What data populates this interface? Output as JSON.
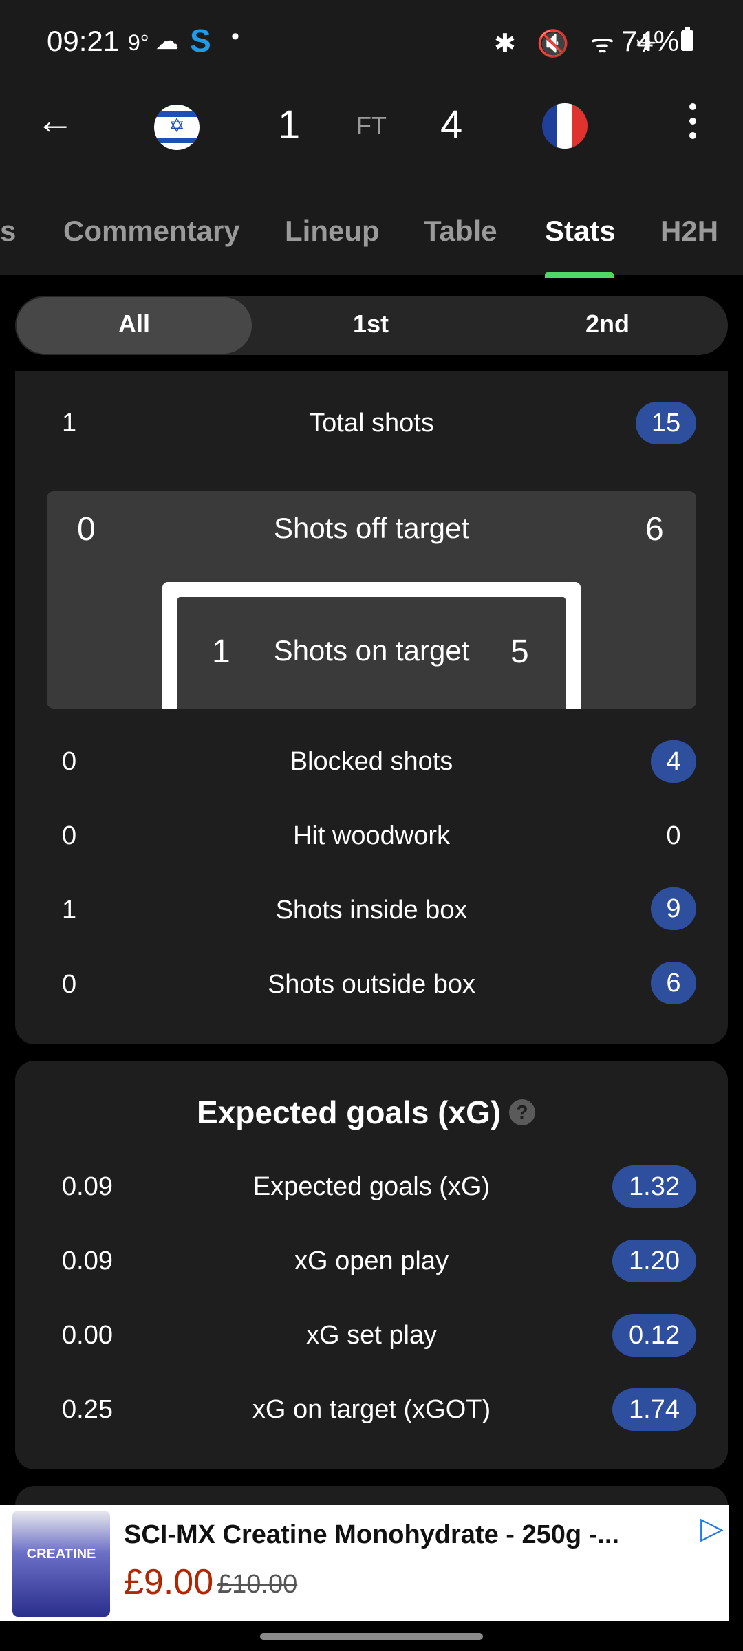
{
  "status": {
    "time": "09:21",
    "temp": "9°",
    "weather_icon": "☁",
    "s_icon": "S",
    "dot": "•",
    "right_icons": "✱ 🔇 ᯤ ✈",
    "battery": "74%"
  },
  "match": {
    "home_score": "1",
    "status": "FT",
    "away_score": "4",
    "home_flag": "israel-flag",
    "away_flag": "france-flag",
    "colors": {
      "fr_blue": "#1f3f9a",
      "fr_white": "#ffffff",
      "fr_red": "#e0332f",
      "il_blue": "#1c4fb8"
    }
  },
  "tabs": [
    {
      "label": "s"
    },
    {
      "label": "Commentary"
    },
    {
      "label": "Lineup"
    },
    {
      "label": "Table"
    },
    {
      "label": "Stats",
      "active": true
    },
    {
      "label": "H2H"
    }
  ],
  "periods": [
    "All",
    "1st",
    "2nd"
  ],
  "shots": {
    "total": {
      "label": "Total shots",
      "home": "1",
      "away": "15"
    },
    "off_target": {
      "label": "Shots off target",
      "home": "0",
      "away": "6"
    },
    "on_target": {
      "label": "Shots on target",
      "home": "1",
      "away": "5"
    },
    "rows": [
      {
        "label": "Blocked shots",
        "home": "0",
        "away": "4",
        "highlight": true
      },
      {
        "label": "Hit woodwork",
        "home": "0",
        "away": "0",
        "highlight": false
      },
      {
        "label": "Shots inside box",
        "home": "1",
        "away": "9",
        "highlight": true
      },
      {
        "label": "Shots outside box",
        "home": "0",
        "away": "6",
        "highlight": true
      }
    ]
  },
  "xg": {
    "title": "Expected goals (xG)",
    "help_icon": "?",
    "rows": [
      {
        "label": "Expected goals (xG)",
        "home": "0.09",
        "away": "1.32"
      },
      {
        "label": "xG open play",
        "home": "0.09",
        "away": "1.20"
      },
      {
        "label": "xG set play",
        "home": "0.00",
        "away": "0.12"
      },
      {
        "label": "xG on target (xGOT)",
        "home": "0.25",
        "away": "1.74"
      }
    ]
  },
  "ad": {
    "product_image_text": "CREATINE",
    "title": "SCI-MX Creatine Monohydrate - 250g -...",
    "price": "£9.00",
    "old_price": "£10.00",
    "play_icon": "ad-choices-icon"
  }
}
